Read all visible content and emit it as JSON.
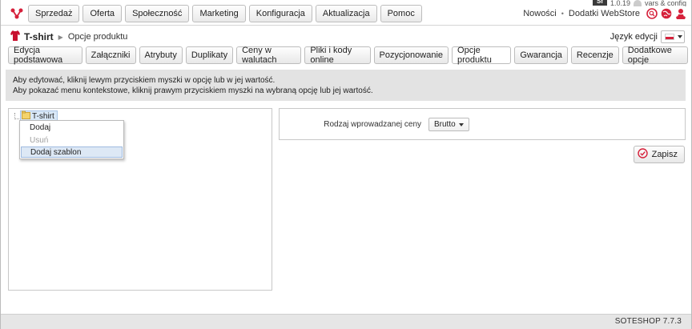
{
  "debug": {
    "logo": "Sf",
    "version": "1.0.19",
    "config": "vars & config"
  },
  "nav": {
    "items": [
      "Sprzedaż",
      "Oferta",
      "Społeczność",
      "Marketing",
      "Konfiguracja",
      "Aktualizacja",
      "Pomoc"
    ],
    "right_links": [
      "Nowości",
      "Dodatki WebStore"
    ],
    "separator": "•"
  },
  "breadcrumb": {
    "title": "T-shirt",
    "page": "Opcje produktu"
  },
  "language": {
    "label": "Język edycji"
  },
  "tabs": [
    "Edycja podstawowa",
    "Załączniki",
    "Atrybuty",
    "Duplikaty",
    "Ceny w walutach",
    "Pliki i kody online",
    "Pozycjonowanie",
    "Opcje produktu",
    "Gwarancja",
    "Recenzje",
    "Dodatkowe opcje"
  ],
  "active_tab": "Opcje produktu",
  "info": {
    "line1": "Aby edytować, kliknij lewym przyciskiem myszki w opcję lub w jej wartość.",
    "line2": "Aby pokazać menu kontekstowe, kliknij prawym przyciskiem myszki na wybraną opcję lub jej wartość."
  },
  "tree": {
    "root": "T-shirt"
  },
  "context_menu": {
    "items": [
      "Dodaj",
      "Usuń",
      "Dodaj szablon"
    ],
    "disabled": "Usuń",
    "hover": "Dodaj szablon"
  },
  "form": {
    "price_label": "Rodzaj wprowadzanej ceny",
    "price_value": "Brutto"
  },
  "save": {
    "label": "Zapisz"
  },
  "footer": {
    "version": "SOTESHOP 7.7.3"
  },
  "colors": {
    "accent_red": "#d6213b",
    "bg_gray": "#e3e3e3"
  }
}
